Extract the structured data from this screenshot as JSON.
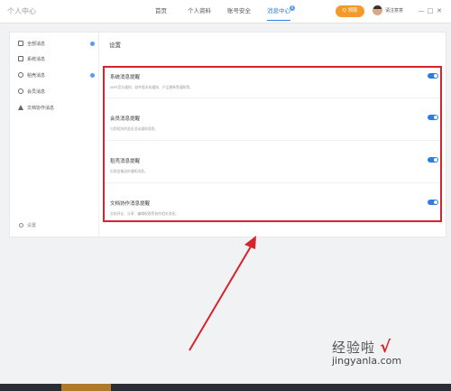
{
  "window": {
    "title": "个人中心",
    "nav": [
      "首页",
      "个人资料",
      "账号安全",
      "消息中心"
    ],
    "nav_badge": "0",
    "cta_label": "Q 领取",
    "user_name": "请注意意",
    "controls": [
      "—",
      "□",
      "✕"
    ]
  },
  "sidebar": {
    "items": [
      {
        "label": "全部消息",
        "icon": "message-icon",
        "dot": true
      },
      {
        "label": "系统消息",
        "icon": "system-icon",
        "dot": false
      },
      {
        "label": "稻壳消息",
        "icon": "docer-icon",
        "dot": true
      },
      {
        "label": "会员消息",
        "icon": "vip-icon",
        "dot": false
      },
      {
        "label": "文档协作消息",
        "icon": "collab-icon",
        "dot": false
      }
    ],
    "footer": "设置"
  },
  "main": {
    "title": "设置",
    "settings": [
      {
        "title": "系统消息提醒",
        "desc": "WPS官方通知、软件版本的通知、产品更新等通知等。",
        "enabled": true
      },
      {
        "title": "会员消息提醒",
        "desc": "与您相关的会员活动通知消息。",
        "enabled": true
      },
      {
        "title": "稻壳消息提醒",
        "desc": "后续会推送的通知消息。",
        "enabled": true
      },
      {
        "title": "文档协作消息提醒",
        "desc": "文档评论、分享、编辑权限等协作相关消息。",
        "enabled": true
      }
    ]
  },
  "annotation": {
    "highlight_color": "#d6242c"
  },
  "watermark": {
    "cn": "经验啦",
    "check": "√",
    "en": "jingyanla.com"
  },
  "colors": {
    "accent": "#2f7de1",
    "cta": "#f39a2a"
  }
}
